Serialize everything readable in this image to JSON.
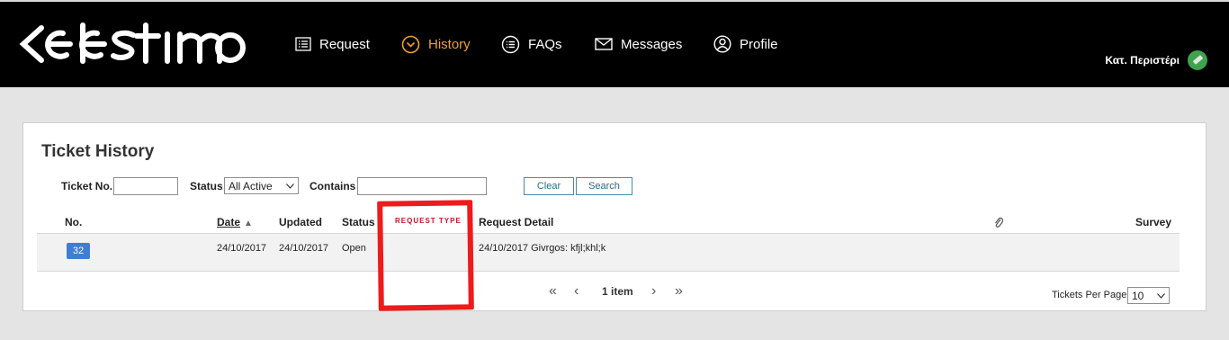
{
  "brand": {
    "logo_text": "celestino"
  },
  "nav": {
    "request": "Request",
    "history": "History",
    "faqs": "FAQs",
    "messages": "Messages",
    "profile": "Profile"
  },
  "user": {
    "name": "Κατ. Περιστέρι"
  },
  "colors": {
    "header_bg": "#000000",
    "active_nav": "#f0a030",
    "badge": "#3f7ed4",
    "user_status": "#3fa34d",
    "highlight": "#ee1b1b"
  },
  "panel": {
    "title": "Ticket History"
  },
  "filters": {
    "ticket_no_label": "Ticket No.",
    "ticket_no_value": "",
    "status_label": "Status",
    "status_value": "All Active",
    "contains_label": "Contains",
    "contains_value": "",
    "clear_label": "Clear",
    "search_label": "Search"
  },
  "table": {
    "headers": {
      "no": "No.",
      "date": "Date",
      "updated": "Updated",
      "status": "Status",
      "request_type": "REQUEST TYPE",
      "request_detail": "Request Detail",
      "survey": "Survey"
    },
    "rows": [
      {
        "no": "32",
        "date": "24/10/2017",
        "updated": "24/10/2017",
        "status": "Open",
        "request_type": "",
        "request_detail": "24/10/2017 Givrgos: kfjl;khl;k"
      }
    ]
  },
  "pagination": {
    "items": "1 item",
    "per_page_label": "Tickets Per Page",
    "per_page_value": "10"
  }
}
